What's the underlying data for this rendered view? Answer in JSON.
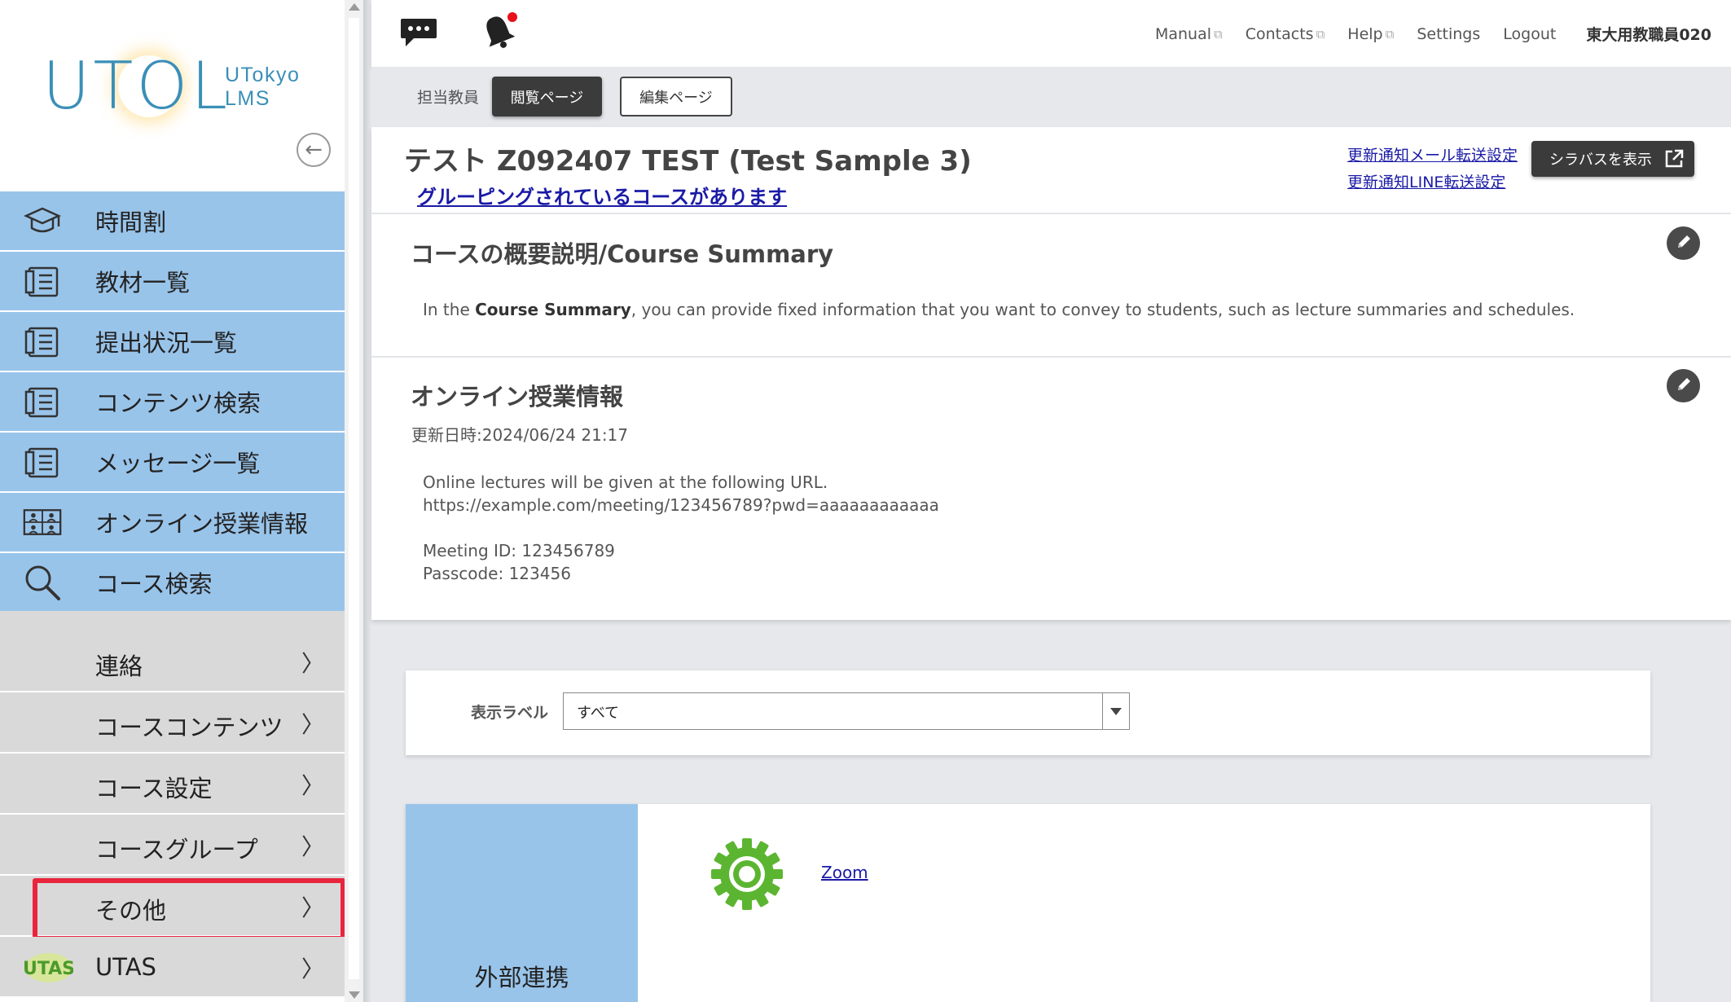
{
  "sidebar": {
    "logo_main": "UTOL",
    "logo_sub_line1": "UTokyo",
    "logo_sub_line2": "LMS",
    "collapse_icon": "arrow-left-circle-icon",
    "primary_items": [
      {
        "label": "時間割",
        "icon": "mortarboard-icon"
      },
      {
        "label": "教材一覧",
        "icon": "list-book-icon"
      },
      {
        "label": "提出状況一覧",
        "icon": "list-book-icon"
      },
      {
        "label": "コンテンツ検索",
        "icon": "list-book-icon"
      },
      {
        "label": "メッセージ一覧",
        "icon": "list-book-icon"
      },
      {
        "label": "オンライン授業情報",
        "icon": "online-class-icon"
      },
      {
        "label": "コース検索",
        "icon": "magnifier-icon"
      }
    ],
    "secondary_items": [
      {
        "label": "連絡",
        "chevron": "〉"
      },
      {
        "label": "コースコンテンツ",
        "chevron": "〉"
      },
      {
        "label": "コース設定",
        "chevron": "〉"
      },
      {
        "label": "コースグループ",
        "chevron": "〉"
      },
      {
        "label": "その他",
        "chevron": "〉",
        "highlighted": true
      },
      {
        "label": "UTAS",
        "chevron": "〉",
        "icon": "utas-logo"
      }
    ],
    "colors": {
      "primary_bg": "#99c4ea",
      "secondary_bg": "#d9d9d9",
      "highlight": "#e8253d",
      "logo": "#3a8fb7"
    }
  },
  "topbar": {
    "links": [
      "Manual",
      "Contacts",
      "Help",
      "Settings",
      "Logout"
    ],
    "external_marker": "⧉",
    "user": "東大用教職員020",
    "notification_dot_color": "#e8101a"
  },
  "tabs": {
    "role": "担当教員",
    "view": "閲覧ページ",
    "edit": "編集ページ"
  },
  "course": {
    "title": "テスト Z092407 TEST (Test Sample 3)",
    "grouping_link": "グルーピングされているコースがあります",
    "notify_mail": "更新通知メール転送設定",
    "notify_line": "更新通知LINE転送設定",
    "syllabus_button": "シラバスを表示"
  },
  "summary": {
    "title": "コースの概要説明/Course Summary",
    "text_before": "In the ",
    "text_bold": "Course Summary",
    "text_after": ", you can provide fixed information that you want to convey to students, such as lecture summaries and schedules."
  },
  "online_info": {
    "title": "オンライン授業情報",
    "updated": "更新日時:2024/06/24 21:17",
    "line1": "Online lectures will be given at the following URL.",
    "line2": "https://example.com/meeting/123456789?pwd=aaaaaaaaaaaa",
    "line3": "Meeting ID: 123456789",
    "line4": "Passcode: 123456"
  },
  "filter": {
    "label": "表示ラベル",
    "value": "すべて"
  },
  "external": {
    "label": "外部連携",
    "tool_name": "Zoom",
    "tool_icon": "gear-icon",
    "tool_icon_color": "#5bb531"
  }
}
